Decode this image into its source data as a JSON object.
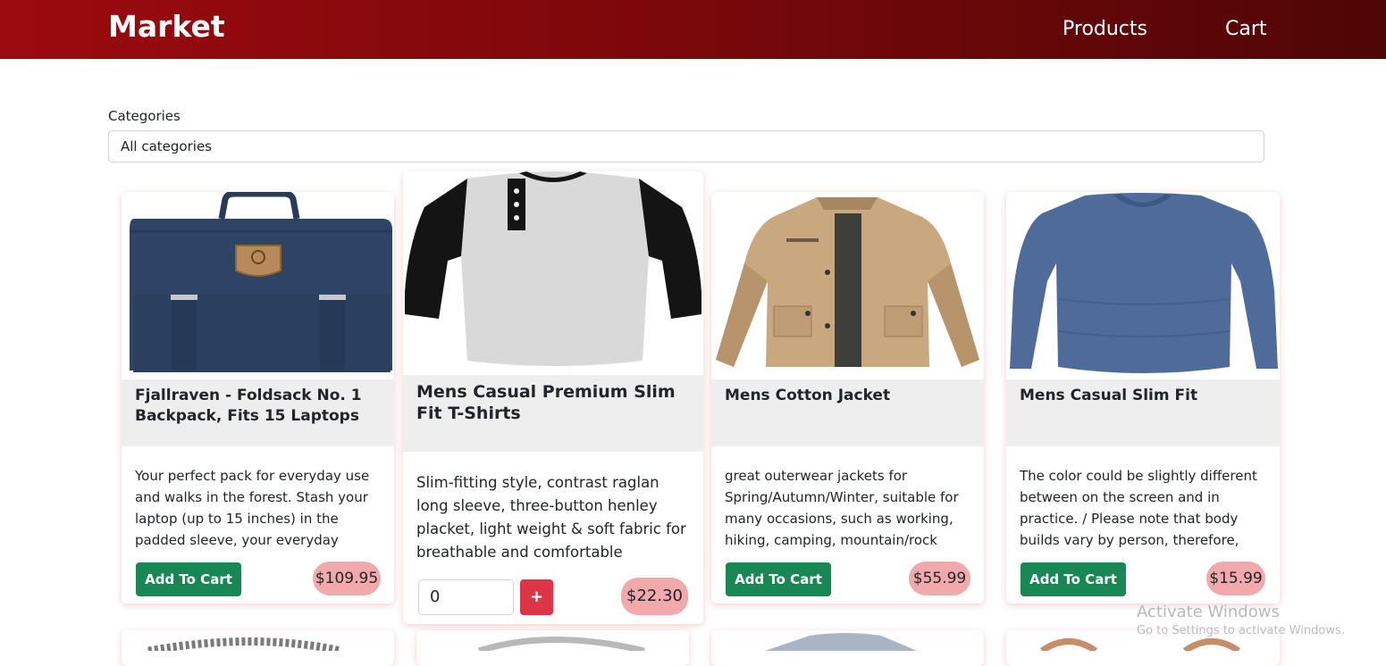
{
  "nav": {
    "brand": "Market",
    "products": "Products",
    "cart": "Cart"
  },
  "filter": {
    "label": "Categories",
    "selected": "All categories"
  },
  "products": [
    {
      "title": "Fjallraven - Foldsack No. 1 Backpack, Fits 15 Laptops",
      "description": "Your perfect pack for everyday use and walks in the forest. Stash your laptop (up to 15 inches) in the padded sleeve, your everyday",
      "add_label": "Add To Cart",
      "price": "$109.95",
      "image": "backpack-image"
    },
    {
      "title": "Mens Casual Premium Slim Fit T-Shirts",
      "description": "Slim-fitting style, contrast raglan long sleeve, three-button henley placket, light weight & soft fabric for breathable and comfortable",
      "quantity": "0",
      "plus_label": "+",
      "price": "$22.30",
      "image": "henley-shirt-image"
    },
    {
      "title": "Mens Cotton Jacket",
      "description": "great outerwear jackets for Spring/Autumn/Winter, suitable for many occasions, such as working, hiking, camping, mountain/rock",
      "add_label": "Add To Cart",
      "price": "$55.99",
      "image": "jacket-image"
    },
    {
      "title": "Mens Casual Slim Fit",
      "description": "The color could be slightly different between on the screen and in practice. / Please note that body builds vary by person, therefore,",
      "add_label": "Add To Cart",
      "price": "$15.99",
      "image": "long-sleeve-shirt-image"
    }
  ],
  "watermark": {
    "title": "Activate Windows",
    "subtitle": "Go to Settings to activate Windows."
  },
  "colors": {
    "navbar": "#8b0a0c",
    "add_button": "#198754",
    "price_badge": "#f1a9ab",
    "plus_button": "#dc3545"
  }
}
